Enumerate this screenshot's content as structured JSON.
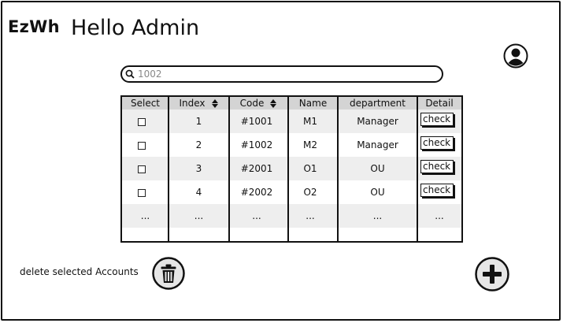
{
  "header": {
    "logo": "EzWh",
    "greeting": "Hello Admin"
  },
  "search": {
    "value": "",
    "placeholder": "1002"
  },
  "table": {
    "columns": [
      "Select",
      "Index",
      "Code",
      "Name",
      "department",
      "Detail"
    ],
    "rows": [
      {
        "index": "1",
        "code": "#1001",
        "name": "M1",
        "department": "Manager",
        "detail": "check"
      },
      {
        "index": "2",
        "code": "#1002",
        "name": "M2",
        "department": "Manager",
        "detail": "check"
      },
      {
        "index": "3",
        "code": "#2001",
        "name": "O1",
        "department": "OU",
        "detail": "check"
      },
      {
        "index": "4",
        "code": "#2002",
        "name": "O2",
        "department": "OU",
        "detail": "check"
      }
    ],
    "ellipsis": "..."
  },
  "footer": {
    "delete_label": "delete selected Accounts"
  },
  "icons": {
    "user": "user-avatar-icon",
    "search": "search-icon",
    "trash": "trash-icon",
    "add": "plus-icon",
    "sort": "sort-icon"
  }
}
